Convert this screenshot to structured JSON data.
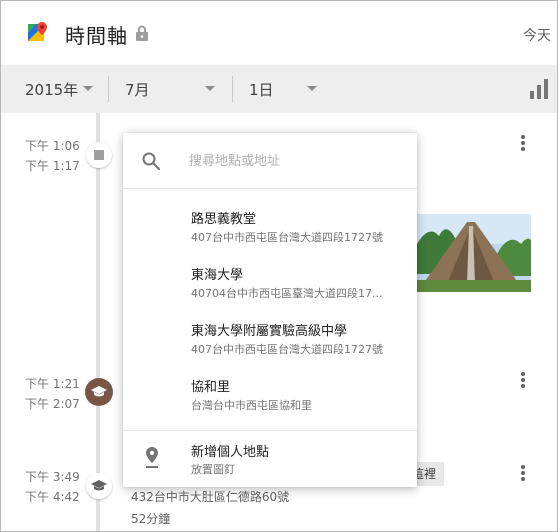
{
  "header": {
    "title": "時間軸",
    "today": "今天"
  },
  "datebar": {
    "year": "2015年",
    "month": "7月",
    "day": "1日"
  },
  "timeline": {
    "entries": [
      {
        "start": "下午 1:06",
        "end": "下午 1:17"
      },
      {
        "start": "下午 1:21",
        "end": "下午 2:07"
      },
      {
        "start": "下午 3:49",
        "end": "下午 4:42"
      }
    ],
    "partial_address": "432台中市大肚區仁德路60號",
    "partial_duration": "52分鐘",
    "partial_chip": "這裡"
  },
  "popup": {
    "search_placeholder": "搜尋地點或地址",
    "results": [
      {
        "name": "路思義教堂",
        "address": "407台中市西屯區台灣大道四段1727號"
      },
      {
        "name": "東海大學",
        "address": "40704台中市西屯區臺灣大道四段17..."
      },
      {
        "name": "東海大學附屬實驗高級中學",
        "address": "407台中市西屯區台灣大道四段1727號"
      },
      {
        "name": "協和里",
        "address": "台灣台中市西屯區協和里"
      }
    ],
    "add_place": {
      "name": "新增個人地點",
      "sub": "放置圖釘"
    }
  },
  "colors": {
    "datebar_bg": "#eeeeee",
    "timeline_line": "#e0e0e0",
    "education_node": "#795548"
  }
}
